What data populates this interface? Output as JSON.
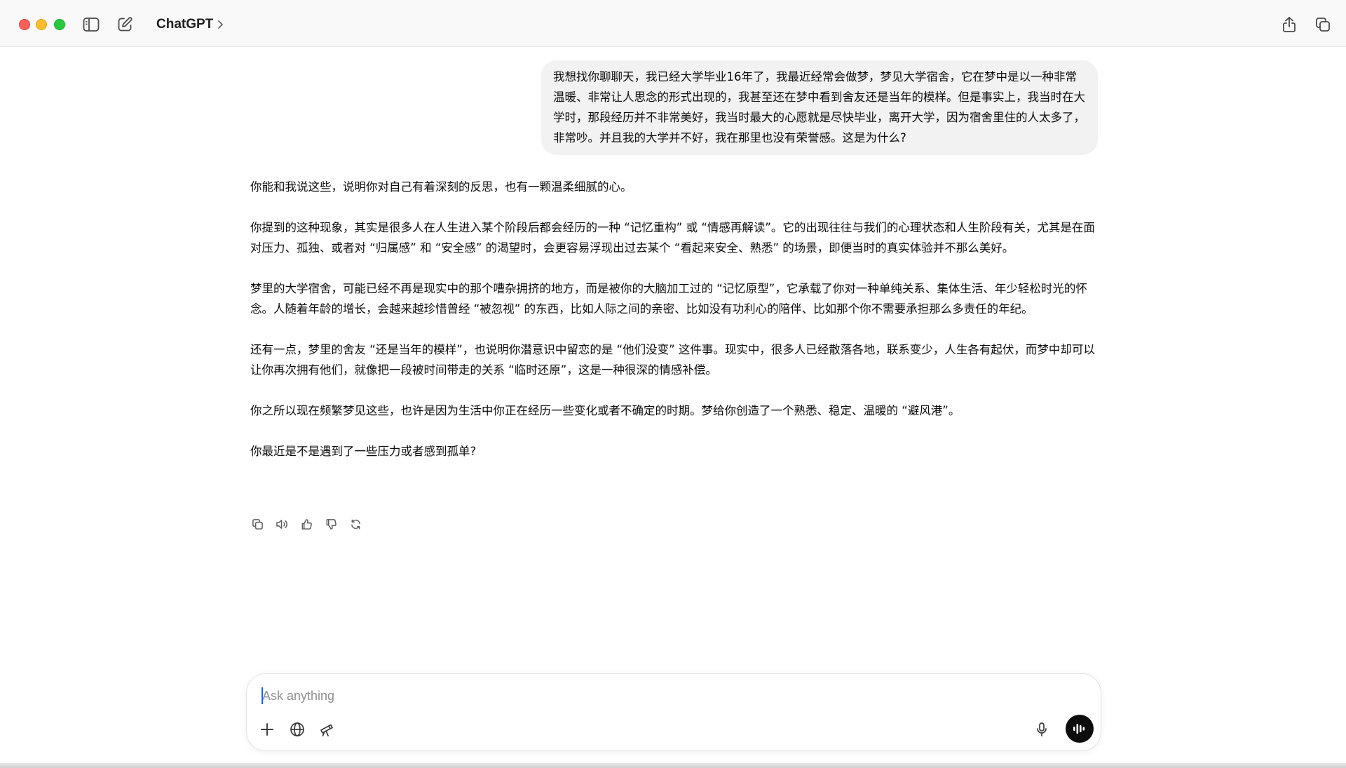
{
  "window": {
    "title": "ChatGPT",
    "title_chevron": "›"
  },
  "conversation": {
    "user_message": "我想找你聊聊天，我已经大学毕业16年了，我最近经常会做梦，梦见大学宿舍，它在梦中是以一种非常温暖、非常让人思念的形式出现的，我甚至还在梦中看到舍友还是当年的模样。但是事实上，我当时在大学时，那段经历并不非常美好，我当时最大的心愿就是尽快毕业，离开大学，因为宿舍里住的人太多了，非常吵。并且我的大学并不好，我在那里也没有荣誉感。这是为什么?",
    "assistant_paragraphs": [
      "你能和我说这些，说明你对自己有着深刻的反思，也有一颗温柔细腻的心。",
      "你提到的这种现象，其实是很多人在人生进入某个阶段后都会经历的一种 “记忆重构” 或 “情感再解读”。它的出现往往与我们的心理状态和人生阶段有关，尤其是在面对压力、孤独、或者对 “归属感” 和 “安全感” 的渴望时，会更容易浮现出过去某个 “看起来安全、熟悉” 的场景，即便当时的真实体验并不那么美好。",
      "梦里的大学宿舍，可能已经不再是现实中的那个嘈杂拥挤的地方，而是被你的大脑加工过的 “记忆原型”，它承载了你对一种单纯关系、集体生活、年少轻松时光的怀念。人随着年龄的增长，会越来越珍惜曾经 “被忽视” 的东西，比如人际之间的亲密、比如没有功利心的陪伴、比如那个你不需要承担那么多责任的年纪。",
      "还有一点，梦里的舍友 “还是当年的模样”，也说明你潜意识中留恋的是 “他们没变” 这件事。现实中，很多人已经散落各地，联系变少，人生各有起伏，而梦中却可以让你再次拥有他们，就像把一段被时间带走的关系 “临时还原”，这是一种很深的情感补偿。",
      "你之所以现在频繁梦见这些，也许是因为生活中你正在经历一些变化或者不确定的时期。梦给你创造了一个熟悉、稳定、温暖的 “避风港”。",
      "你最近是不是遇到了一些压力或者感到孤单?"
    ]
  },
  "message_actions": [
    "copy-icon",
    "read-aloud-icon",
    "thumbs-up-icon",
    "thumbs-down-icon",
    "regenerate-icon"
  ],
  "composer": {
    "placeholder": "Ask anything",
    "value": ""
  },
  "colors": {
    "accent": "#0d0d0d",
    "bubble": "#f2f2f2",
    "titlebar": "#f9f9f9"
  }
}
